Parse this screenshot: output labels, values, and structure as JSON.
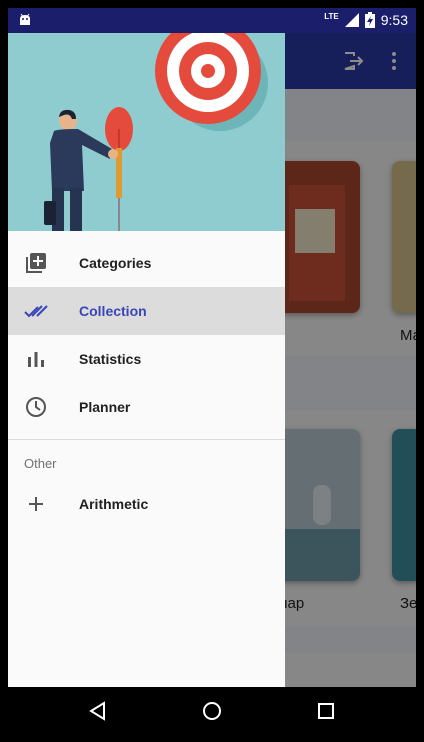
{
  "status_bar": {
    "network": "LTE",
    "time": "9:53"
  },
  "background": {
    "card_captions": [
      "Ма",
      "ллар",
      "Зе"
    ]
  },
  "drawer": {
    "items": [
      {
        "label": "Categories",
        "icon": "add-box-icon"
      },
      {
        "label": "Collection",
        "icon": "double-check-icon",
        "active": true
      },
      {
        "label": "Statistics",
        "icon": "bar-chart-icon"
      },
      {
        "label": "Planner",
        "icon": "clock-icon"
      }
    ],
    "other_header": "Other",
    "other_items": [
      {
        "label": "Arithmetic",
        "icon": "plus-icon"
      }
    ]
  },
  "colors": {
    "status_bar": "#1a1e6b",
    "toolbar": "#2a3aa6",
    "accent": "#3a46b8",
    "header_bg": "#8fccd0",
    "active_item_bg": "#dcdcdc"
  }
}
